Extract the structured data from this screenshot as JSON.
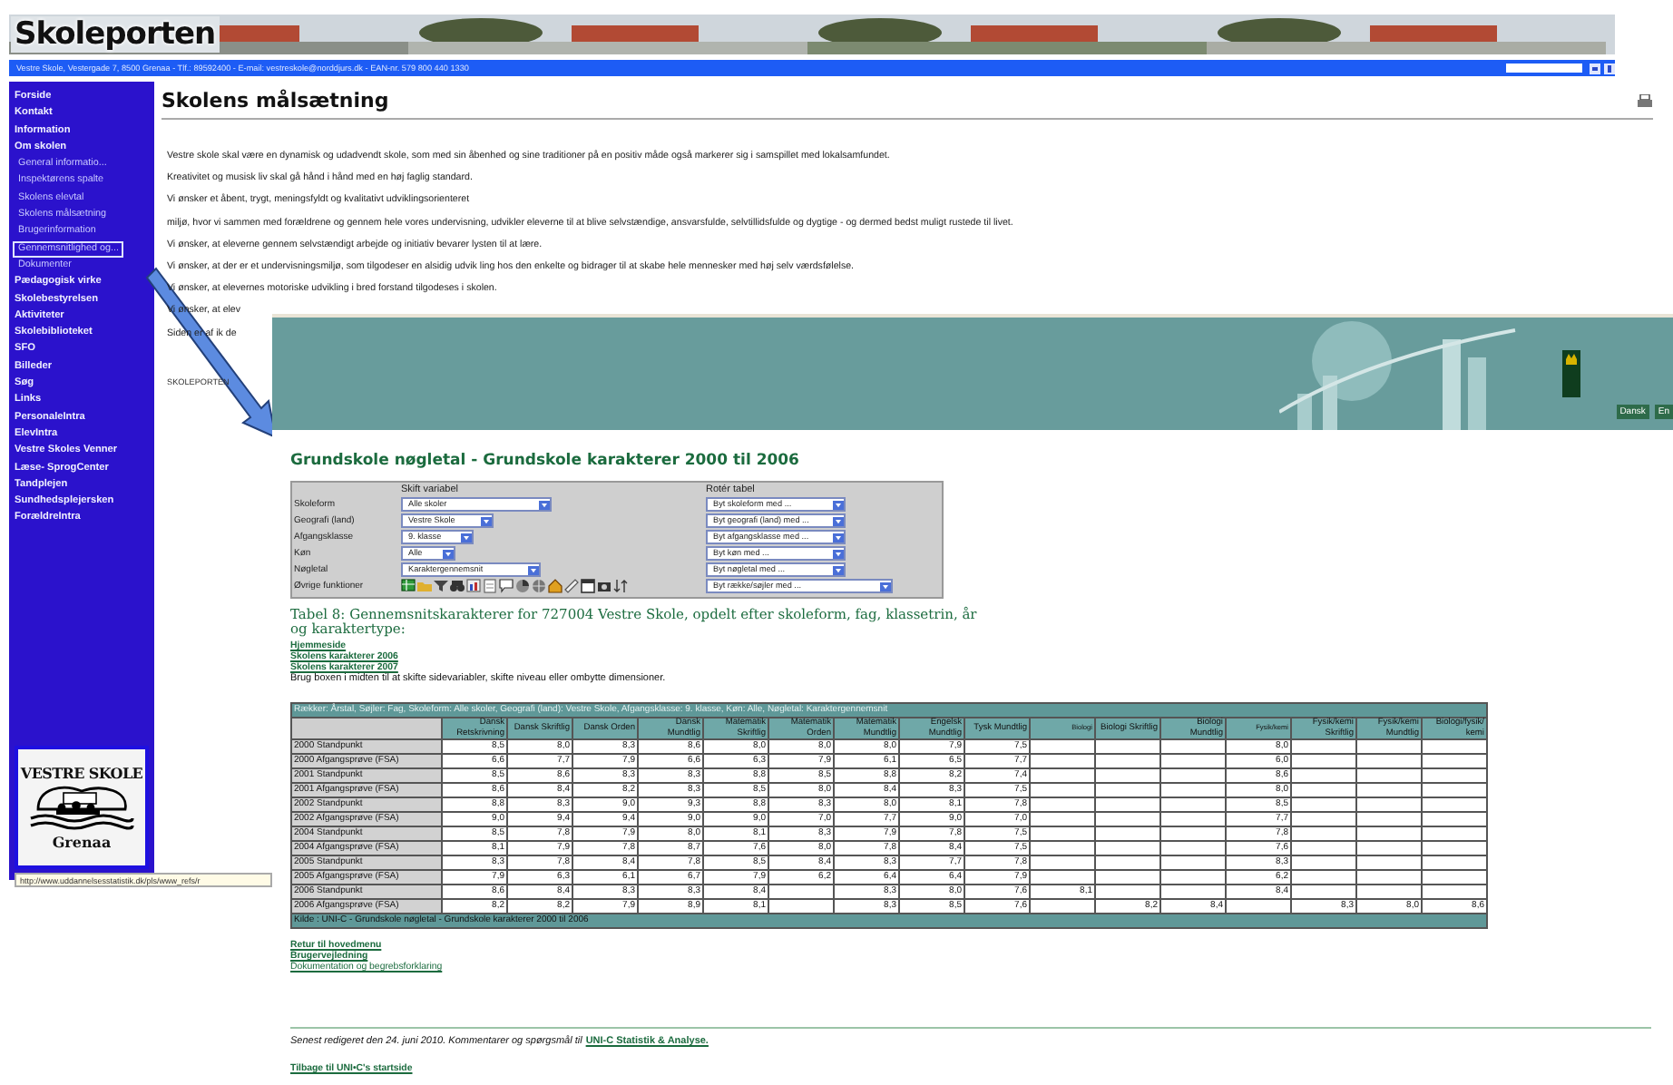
{
  "header": {
    "logo": "Skoleporten",
    "address": "Vestre Skole, Vestergade 7, 8500 Grenaa - Tlf.: 89592400 - E-mail: vestreskole@norddjurs.dk - EAN-nr. 579 800 440 1330"
  },
  "sidebar": {
    "items": [
      {
        "label": "Forside",
        "selected": false
      },
      {
        "label": "Kontakt",
        "selected": false
      },
      {
        "label": "Information",
        "selected": false
      },
      {
        "label": "Om skolen",
        "selected": false,
        "children": [
          {
            "label": "General informatio...",
            "selected": false
          },
          {
            "label": "Inspektørens spalte",
            "selected": false
          },
          {
            "label": "Skolens elevtal",
            "selected": false
          },
          {
            "label": "Skolens målsætning",
            "selected": false
          },
          {
            "label": "Brugerinformation",
            "selected": false
          },
          {
            "label": "Gennemsnitlighed og...",
            "selected": true
          },
          {
            "label": "Dokumenter",
            "selected": false
          }
        ]
      },
      {
        "label": "Pædagogisk virke",
        "selected": false
      },
      {
        "label": "Skolebestyrelsen",
        "selected": false
      },
      {
        "label": "Aktiviteter",
        "selected": false
      },
      {
        "label": "Skolebiblioteket",
        "selected": false
      },
      {
        "label": "SFO",
        "selected": false
      },
      {
        "label": "Billeder",
        "selected": false
      },
      {
        "label": "Søg",
        "selected": false
      },
      {
        "label": "Links",
        "selected": false
      },
      {
        "label": "PersonaleIntra",
        "selected": false
      },
      {
        "label": "ElevIntra",
        "selected": false
      },
      {
        "label": "Vestre Skoles Venner",
        "selected": false
      },
      {
        "label": "Læse- SprogCenter",
        "selected": false
      },
      {
        "label": "Tandplejen",
        "selected": false
      },
      {
        "label": "Sundhedsplejersken",
        "selected": false
      },
      {
        "label": "ForældreIntra",
        "selected": false
      }
    ],
    "logo": {
      "top": "VESTRE SKOLE",
      "bottom": "Grenaa"
    }
  },
  "status_url": "http://www.uddannelsesstatistik.dk/pls/www_refs/r",
  "page": {
    "title": "Skolens målsætning",
    "paragraphs": [
      "Vestre skole skal være en dynamisk og udadvendt skole, som med sin åbenhed og sine traditioner på en positiv måde også markerer sig i samspillet med lokalsamfundet.",
      "Kreativitet og musisk liv skal gå hånd i hånd med en høj faglig standard.",
      "Vi ønsker et åbent, trygt, meningsfyldt og kvalitativt udviklingsorienteret",
      "miljø, hvor vi sammen med forældrene og gennem hele vores undervisning, udvikler eleverne til at blive selvstændige, ansvarsfulde, selvtillidsfulde og dygtige - og dermed bedst muligt rustede til livet.",
      "Vi ønsker, at eleverne gennem selvstændigt arbejde og initiativ bevarer lysten til at lære.",
      "Vi ønsker, at der er et undervisningsmiljø, som tilgodeser en alsidig udvik ling hos den enkelte og bidrager til at skabe hele mennesker med høj selv værdsfølelse.",
      "Vi ønsker, at elevernes motoriske udvikling i bred forstand tilgodeses i skolen.",
      "Vi ønsker, at elev",
      "Siden er af ik de"
    ],
    "footer_label": "SKOLEPORTEN"
  },
  "overlay": {
    "buttons": [
      "Dansk",
      "En"
    ],
    "title": "Grundskole nøgletal - Grundskole karakterer 2000 til 2006",
    "panel": {
      "left_heading": "Skift variabel",
      "right_heading": "Rotér tabel",
      "rows": [
        {
          "label": "Skoleform",
          "value": "Alle skoler",
          "rotate": "Byt skoleform med ..."
        },
        {
          "label": "Geografi (land)",
          "value": "Vestre Skole",
          "rotate": "Byt geografi (land) med ..."
        },
        {
          "label": "Afgangsklasse",
          "value": "9. klasse",
          "rotate": "Byt afgangsklasse med ..."
        },
        {
          "label": "Køn",
          "value": "Alle",
          "rotate": "Byt køn med ..."
        },
        {
          "label": "Nøgletal",
          "value": "Karaktergennemsnit",
          "rotate": "Byt nøgletal med ..."
        }
      ],
      "functions_label": "Øvrige funktioner",
      "functions_rotate": "Byt række/søjler med ..."
    },
    "table_title": "Tabel 8: Gennemsnitskarakterer for 727004 Vestre Skole, opdelt efter skoleform, fag, klassetrin, år og karaktertype:",
    "links": [
      "Hjemmeside",
      "Skolens karakterer 2006",
      "Skolens karakterer 2007"
    ],
    "hint": "Brug boxen i midten til at skifte sidevariabler, skifte niveau eller ombytte dimensioner.",
    "table": {
      "caption": "Rækker: Årstal, Søjler: Fag, Skoleform: Alle skoler, Geografi (land): Vestre Skole, Afgangsklasse: 9. klasse, Køn: Alle, Nøgletal: Karaktergennemsnit",
      "columns": [
        "Dansk Retskrivning",
        "Dansk Skriftlig",
        "Dansk Orden",
        "Dansk Mundtlig",
        "Matematik Skriftlig",
        "Matematik Orden",
        "Matematik Mundtlig",
        "Engelsk Mundtlig",
        "Tysk Mundtlig",
        "Biologi",
        "Biologi Skriftlig",
        "Biologi Mundtlig",
        "Fysik/kemi",
        "Fysik/kemi Skriftlig",
        "Fysik/kemi Mundtlig",
        "Biologi/fysik/ kemi"
      ],
      "rows": [
        {
          "label": "2000 Standpunkt",
          "cells": [
            "8,5",
            "8,0",
            "8,3",
            "8,6",
            "8,0",
            "8,0",
            "8,0",
            "7,9",
            "7,5",
            null,
            null,
            null,
            "8,0",
            null,
            null,
            null
          ]
        },
        {
          "label": "2000 Afgangsprøve (FSA)",
          "cells": [
            "6,6",
            "7,7",
            "7,9",
            "6,6",
            "6,3",
            "7,9",
            "6,1",
            "6,5",
            "7,7",
            null,
            null,
            null,
            "6,0",
            null,
            null,
            null
          ]
        },
        {
          "label": "2001 Standpunkt",
          "cells": [
            "8,5",
            "8,6",
            "8,3",
            "8,3",
            "8,8",
            "8,5",
            "8,8",
            "8,2",
            "7,4",
            null,
            null,
            null,
            "8,6",
            null,
            null,
            null
          ]
        },
        {
          "label": "2001 Afgangsprøve (FSA)",
          "cells": [
            "8,6",
            "8,4",
            "8,2",
            "8,3",
            "8,5",
            "8,0",
            "8,4",
            "8,3",
            "7,5",
            null,
            null,
            null,
            "8,0",
            null,
            null,
            null
          ]
        },
        {
          "label": "2002 Standpunkt",
          "cells": [
            "8,8",
            "8,3",
            "9,0",
            "9,3",
            "8,8",
            "8,3",
            "8,0",
            "8,1",
            "7,8",
            null,
            null,
            null,
            "8,5",
            null,
            null,
            null
          ]
        },
        {
          "label": "2002 Afgangsprøve (FSA)",
          "cells": [
            "9,0",
            "9,4",
            "9,4",
            "9,0",
            "9,0",
            "7,0",
            "7,7",
            "9,0",
            "7,0",
            null,
            null,
            null,
            "7,7",
            null,
            null,
            null
          ]
        },
        {
          "label": "2004 Standpunkt",
          "cells": [
            "8,5",
            "7,8",
            "7,9",
            "8,0",
            "8,1",
            "8,3",
            "7,9",
            "7,8",
            "7,5",
            null,
            null,
            null,
            "7,8",
            null,
            null,
            null
          ]
        },
        {
          "label": "2004 Afgangsprøve (FSA)",
          "cells": [
            "8,1",
            "7,9",
            "7,8",
            "8,7",
            "7,6",
            "8,0",
            "7,8",
            "8,4",
            "7,5",
            null,
            null,
            null,
            "7,6",
            null,
            null,
            null
          ]
        },
        {
          "label": "2005 Standpunkt",
          "cells": [
            "8,3",
            "7,8",
            "8,4",
            "7,8",
            "8,5",
            "8,4",
            "8,3",
            "7,7",
            "7,8",
            null,
            null,
            null,
            "8,3",
            null,
            null,
            null
          ]
        },
        {
          "label": "2005 Afgangsprøve (FSA)",
          "cells": [
            "7,9",
            "6,3",
            "6,1",
            "6,7",
            "7,9",
            "6,2",
            "6,4",
            "6,4",
            "7,9",
            null,
            null,
            null,
            "6,2",
            null,
            null,
            null
          ]
        },
        {
          "label": "2006 Standpunkt",
          "cells": [
            "8,6",
            "8,4",
            "8,3",
            "8,3",
            "8,4",
            null,
            "8,3",
            "8,0",
            "7,6",
            "8,1",
            null,
            null,
            "8,4",
            null,
            null,
            null
          ]
        },
        {
          "label": "2006 Afgangsprøve (FSA)",
          "cells": [
            "8,2",
            "8,2",
            "7,9",
            "8,9",
            "8,1",
            null,
            "8,3",
            "8,5",
            "7,6",
            null,
            "8,2",
            "8,4",
            null,
            "8,3",
            "8,0",
            "8,6"
          ]
        }
      ],
      "source": "Kilde : UNI-C - Grundskole nøgletal - Grundskole karakterer 2000 til 2006"
    },
    "bottom_links": [
      "Retur til hovedmenu",
      "Brugervejledning",
      "Dokumentation og begrebsforklaring"
    ],
    "edited_text": "Senest redigeret den 24. juni 2010. Kommentarer og spørgsmål til",
    "edited_link": "UNI-C Statistik & Analyse.",
    "back_link": "Tilbage til UNI•C's startside"
  }
}
